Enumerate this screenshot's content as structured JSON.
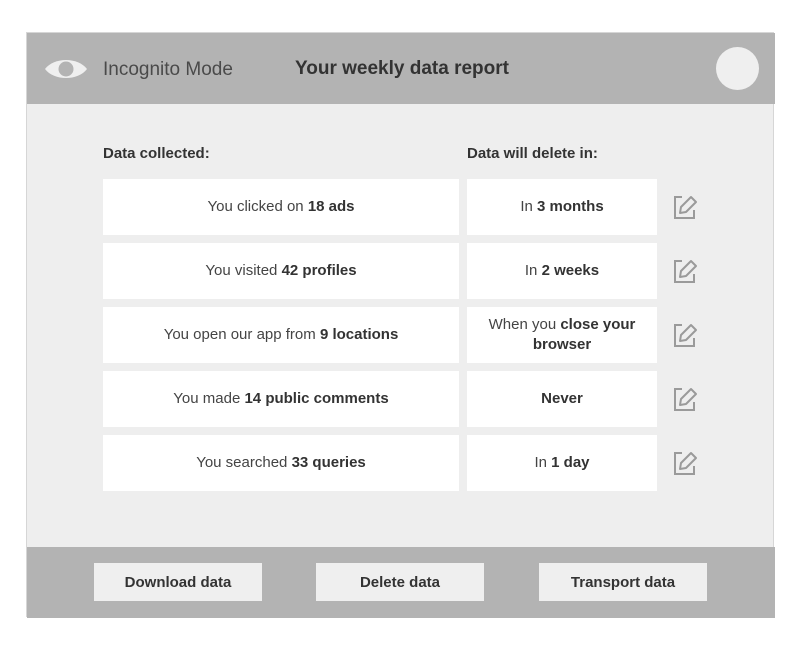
{
  "header": {
    "mode_label": "Incognito Mode",
    "title": "Your weekly data report"
  },
  "columns": {
    "collected": "Data collected:",
    "delete_in": "Data will delete in:"
  },
  "rows": [
    {
      "pre": "You clicked on ",
      "bold": "18 ads",
      "d_pre": "In ",
      "d_bold": "3 months"
    },
    {
      "pre": "You visited ",
      "bold": "42 profiles",
      "d_pre": "In ",
      "d_bold": "2 weeks"
    },
    {
      "pre": "You open our app from ",
      "bold": "9 locations",
      "d_pre": "When you ",
      "d_bold": "close your browser"
    },
    {
      "pre": "You made ",
      "bold": "14 public comments",
      "d_pre": "",
      "d_bold": "Never"
    },
    {
      "pre": "You searched ",
      "bold": "33 queries",
      "d_pre": "In ",
      "d_bold": "1 day"
    }
  ],
  "footer": {
    "download": "Download data",
    "delete": "Delete data",
    "transport": "Transport data"
  },
  "icons": {
    "eye": "eye-icon",
    "edit": "edit-icon"
  },
  "colors": {
    "bar": "#b3b3b3",
    "panel": "#eeeeee",
    "card": "#ffffff"
  }
}
